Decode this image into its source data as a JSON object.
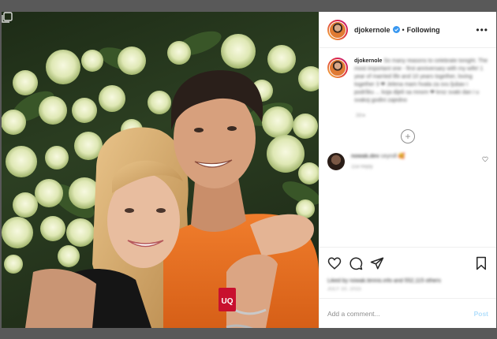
{
  "post": {
    "photo_alt": "",
    "multi_icon": "carousel-icon"
  },
  "header": {
    "username": "djokernole",
    "verified_icon": "verified-badge-icon",
    "separator": "•",
    "follow_status": "Following",
    "more_icon": "more-options-icon",
    "more_label": "•••"
  },
  "caption": {
    "username": "djokernole",
    "text": "So many reasons to celebrate tonight. The most important one - first anniversary with my wife! 1 year of married life and 10 years together, loving together 3 ❤ Jelena mam hvala za svu ljubav i podršku ... koja dijeli sa mnom ❤ kroz svaki dan i u svakoj godini zajedno",
    "time": "2d ▸"
  },
  "load_more": {
    "label": "+",
    "icon": "load-more-icon"
  },
  "comment": {
    "username": "nowak.dev",
    "text": "ceyroll 🥰",
    "meta": "11w Reply",
    "like_icon": "heart-icon"
  },
  "actions": {
    "like_icon": "heart-icon",
    "comment_icon": "comment-icon",
    "share_icon": "share-icon",
    "save_icon": "bookmark-icon"
  },
  "likes": {
    "text": "Liked by nowak.tennis.info and 552,115 others"
  },
  "date": {
    "text": "JULY 10, 2015"
  },
  "add_comment": {
    "placeholder": "Add a comment...",
    "post_label": "Post"
  },
  "colors": {
    "accent_blue": "#3897f0",
    "post_disabled": "#b2dffc",
    "backdrop": "#595959",
    "text": "#262626",
    "muted": "#8e8e8e"
  }
}
